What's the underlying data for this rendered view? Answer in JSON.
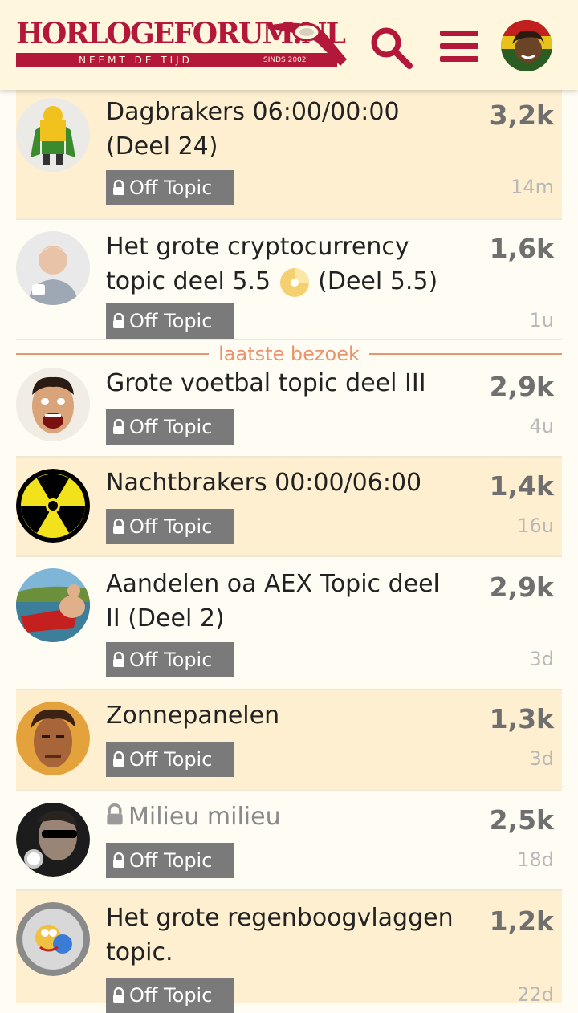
{
  "header": {
    "logo_title": "HORLOGEFORUM.NL",
    "logo_tagline": "NEEMT DE TIJD",
    "logo_since": "SINDS 2002",
    "search_icon": "search-icon",
    "menu_icon": "hamburger-menu-icon",
    "avatar": "user-avatar",
    "accent_color": "#b3173a"
  },
  "divider": {
    "label": "laatste bezoek"
  },
  "topics": [
    {
      "title": "Dagbrakers 06:00/00:00 (Deel 24)",
      "category": "Off Topic",
      "views": "3,2k",
      "age": "14m",
      "highlight": true
    },
    {
      "title": "Het grote cryptocurrency topic deel 5.5",
      "title_suffix": "(Deel 5.5)",
      "category": "Off Topic",
      "views": "1,6k",
      "age": "1u",
      "highlight": false
    },
    {
      "title": "Grote voetbal topic deel III",
      "category": "Off Topic",
      "views": "2,9k",
      "age": "4u",
      "highlight": false
    },
    {
      "title": "Nachtbrakers 00:00/06:00",
      "category": "Off Topic",
      "views": "1,4k",
      "age": "16u",
      "highlight": true
    },
    {
      "title": "Aandelen oa AEX Topic deel II (Deel 2)",
      "category": "Off Topic",
      "views": "2,9k",
      "age": "3d",
      "highlight": false
    },
    {
      "title": "Zonnepanelen",
      "category": "Off Topic",
      "views": "1,3k",
      "age": "3d",
      "highlight": true
    },
    {
      "title": "Milieu milieu",
      "category": "Off Topic",
      "views": "2,5k",
      "age": "18d",
      "highlight": false,
      "closed": true
    },
    {
      "title": "Het grote regenboogvlaggen topic.",
      "category": "Off Topic",
      "views": "1,2k",
      "age": "22d",
      "highlight": true
    }
  ]
}
